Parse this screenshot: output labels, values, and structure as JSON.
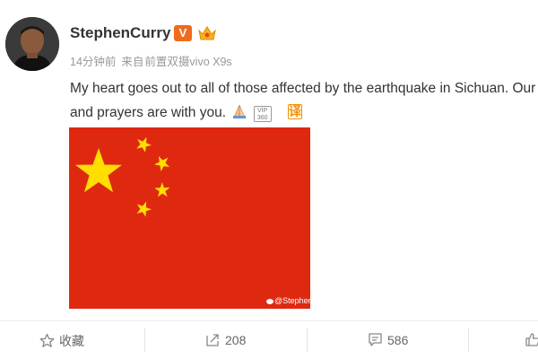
{
  "user": {
    "name": "StephenCurry",
    "verified_label": "V"
  },
  "meta": {
    "time": "14分钟前",
    "source_prefix": "来自",
    "source": "前置双摄vivo X9s"
  },
  "post": {
    "line1": "My heart goes out to all of those affected by the earthquake in Sichuan. Our thoughts",
    "line2": "and prayers are with you.",
    "vip_label_top": "VIP",
    "vip_label_bottom": "360",
    "translate_label": "译",
    "image_watermark": "@StephenCurry"
  },
  "actions": {
    "favorite_label": "收藏",
    "repost_count": "208",
    "comment_count": "586"
  },
  "colors": {
    "flag_red": "#de2910",
    "flag_yellow": "#ffde00",
    "badge_orange": "#f26b1d"
  }
}
